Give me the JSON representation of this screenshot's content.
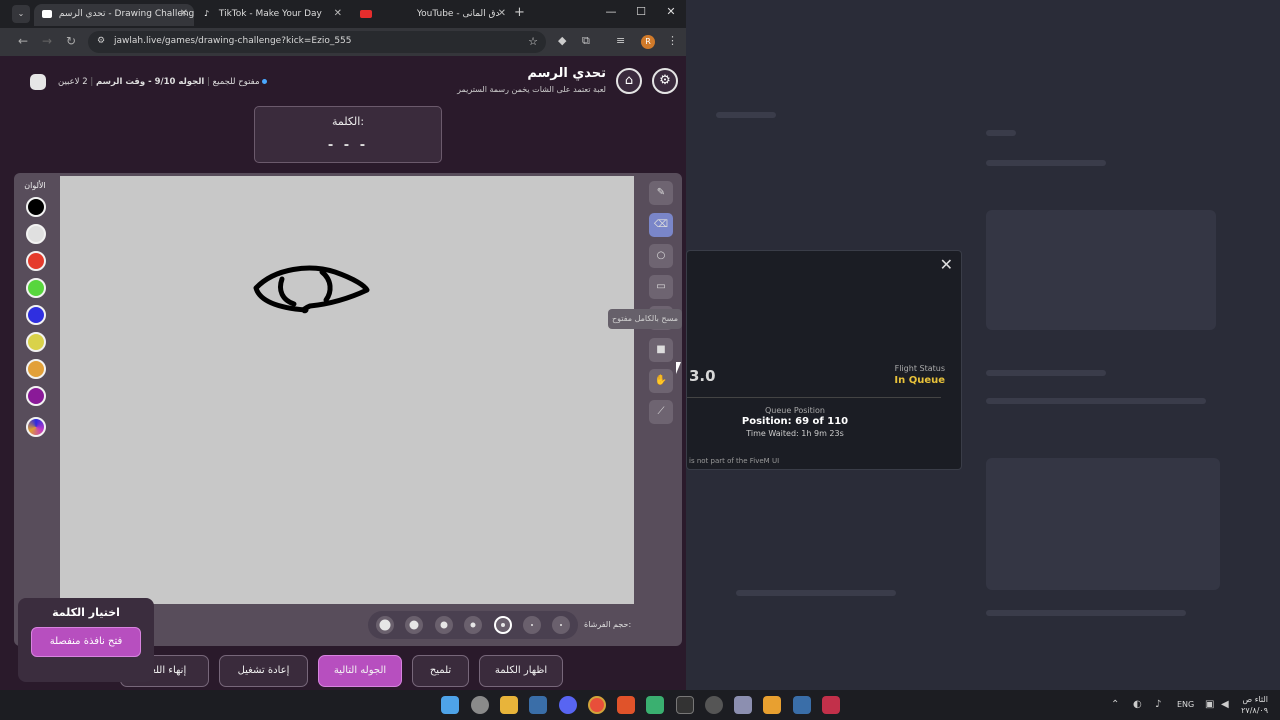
{
  "browser": {
    "tabs": [
      {
        "label": "تحدي الرسم - Drawing Challenge",
        "favicon": "jawlah-icon"
      },
      {
        "label": "TikTok - Make Your Day",
        "favicon": "tiktok-icon"
      },
      {
        "label": "YouTube - دق المانى",
        "favicon": "youtube-icon"
      }
    ],
    "url": "jawlah.live/games/drawing-challenge?kick=Ezio_555",
    "profile_initial": "R"
  },
  "header": {
    "title": "تحدي الرسم",
    "subtitle": "لعبة تعتمد على الشات يخمن رسمة الستريمر",
    "players": "2 لاعبين",
    "round_info": "الجوله 9/10 - وقت الرسم",
    "open_to_all": "مفتوح للجميع"
  },
  "word": {
    "label": "الكلمة:",
    "mask": "- - -"
  },
  "colors": {
    "label": "الألوان",
    "swatches": [
      "#000000",
      "#e0e0e0",
      "#e53b2c",
      "#58d63d",
      "#2f2fe0",
      "#d9d24a",
      "#e2a039",
      "#8a1a98"
    ]
  },
  "tools": {
    "eraser_tooltip": "مسح بالكامل مفتوح"
  },
  "brush": {
    "label": "حجم الفرشاة:"
  },
  "buttons": {
    "reveal_word": "اظهار الكلمة",
    "hint": "تلميح",
    "next_round": "الجوله التالية",
    "restart": "إعادة تشغيل",
    "end_game": "إنهاء اللعبة"
  },
  "word_picker": {
    "title": "اختيار الكلمة",
    "open_window": "فتح نافذة منفصلة"
  },
  "flight": {
    "version": "3.0",
    "status_label": "Flight Status",
    "status": "In Queue",
    "queue_label": "Queue Position",
    "position": "Position: 69 of 110",
    "time_waited": "Time Waited: 1h 9m 23s",
    "footer": "is not part of the FiveM UI"
  },
  "taskbar": {
    "lang": "ENG",
    "time": "الثاء ص",
    "date": "٢٧/٨/٠٩"
  }
}
